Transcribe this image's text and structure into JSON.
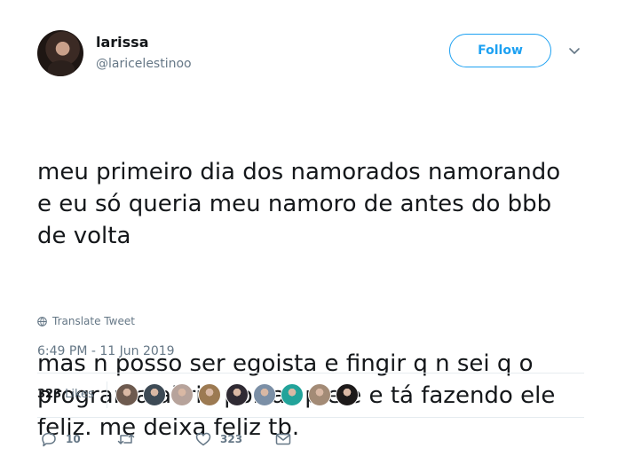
{
  "user": {
    "name": "larissa",
    "handle": "@laricelestinoo"
  },
  "follow_button": {
    "label": "Follow"
  },
  "tweet": {
    "paragraph1": "meu primeiro dia dos namorados namorando\ne eu só queria meu namoro de antes do bbb\nde volta",
    "paragraph2": "mas n posso ser egoista e fingir q n sei q o\nprograma abriu portas p ele e tá fazendo ele\nfeliz. me deixa feliz tb."
  },
  "translate": {
    "label": "Translate Tweet",
    "icon": "globe-icon"
  },
  "timestamp": "6:49 PM - 11 Jun 2019",
  "stats": {
    "likes_count": "323",
    "likes_label": "Likes"
  },
  "likers": [
    {
      "color": "#6d5a4f"
    },
    {
      "color": "#3d4a55"
    },
    {
      "color": "#b7a39b"
    },
    {
      "color": "#9c7a52"
    },
    {
      "color": "#2f2a33"
    },
    {
      "color": "#7b8fa6"
    },
    {
      "color": "#22a39a"
    },
    {
      "color": "#a38b76"
    },
    {
      "color": "#1d1a1a"
    }
  ],
  "actions": {
    "reply_count": "10",
    "retweet_count": "",
    "like_count": "323"
  },
  "colors": {
    "accent": "#1da1f2",
    "secondary_text": "#657786",
    "primary_text": "#14171a",
    "divider": "#e6ecf0"
  }
}
